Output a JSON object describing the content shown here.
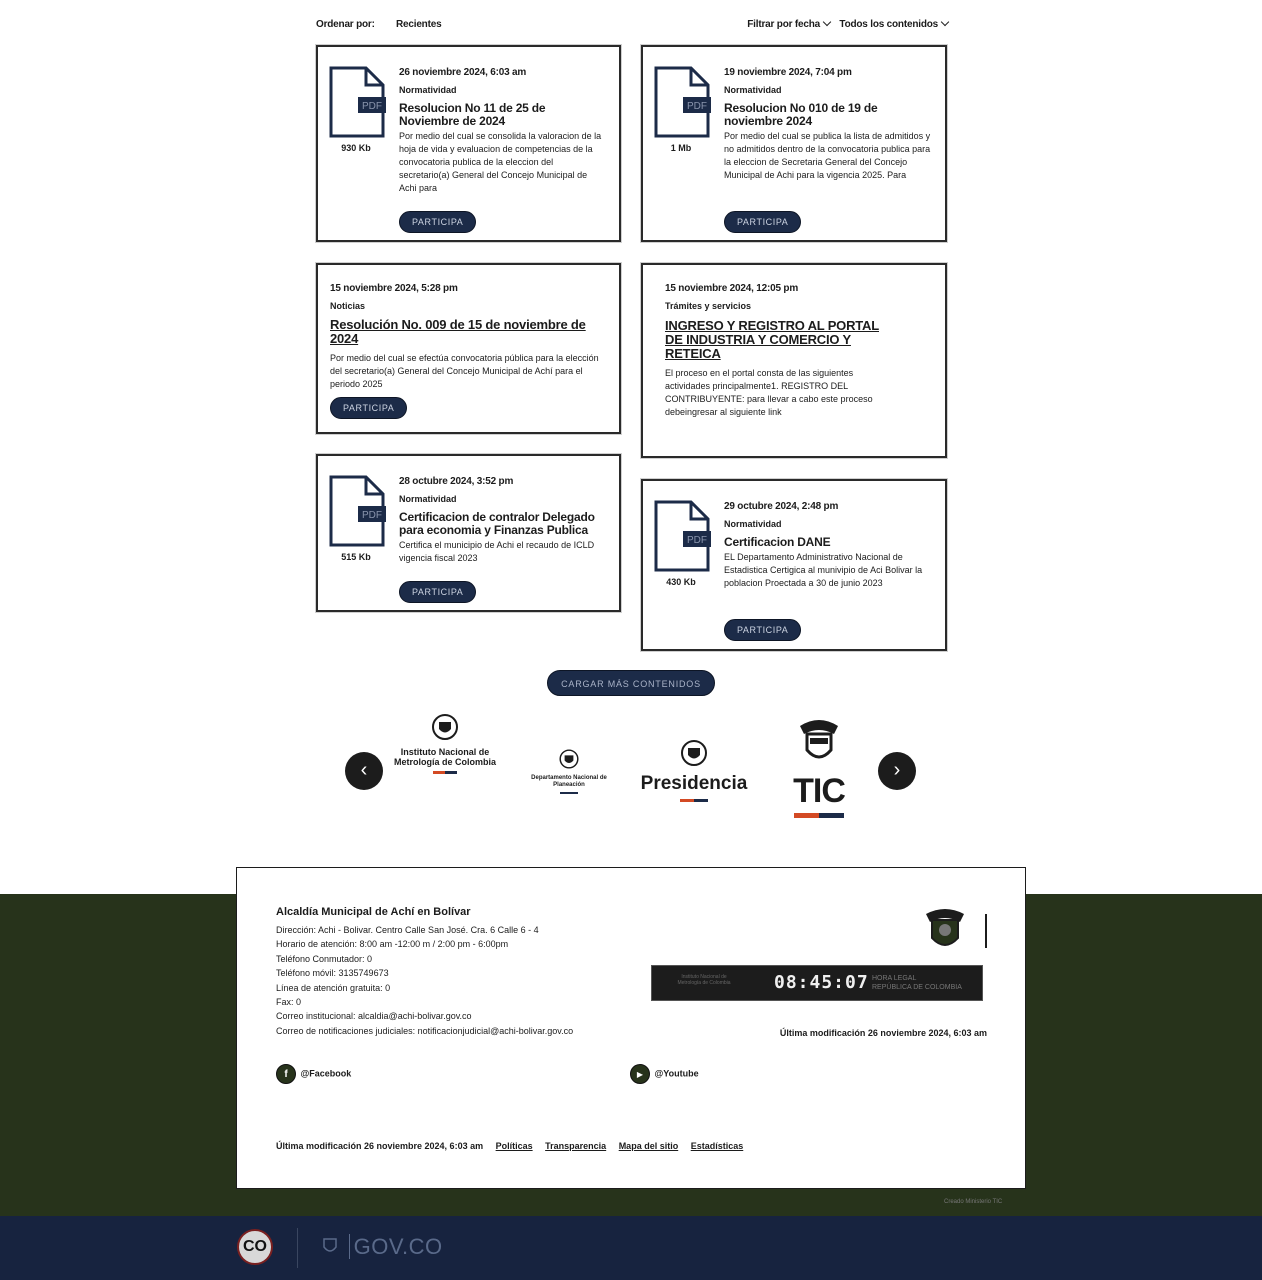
{
  "sort_bar": {
    "label": "Ordenar por:",
    "value": "Recientes",
    "filter_date": "Filtrar por fecha",
    "filter_content": "Todos los contenidos"
  },
  "cards": [
    {
      "date": "26 noviembre 2024, 6:03 am",
      "category": "Normatividad",
      "title": "Resolucion No 11 de 25 de Noviembre de 2024",
      "desc": "Por medio del cual se consolida la valoracion de la hoja de vida y evaluacion de competencias de la convocatoria publica de la eleccion del secretario(a) General del Concejo Municipal de Achi para",
      "file_type": "PDF",
      "file_size": "930 Kb",
      "button": "PARTICIPA"
    },
    {
      "date": "19 noviembre 2024, 7:04 pm",
      "category": "Normatividad",
      "title": "Resolucion No 010 de 19 de noviembre 2024",
      "desc": "Por medio del cual se publica la lista de admitidos y no admitidos dentro de la convocatoria publica para la eleccion de Secretaria General del Concejo Municipal de Achi para la vigencia 2025. Para",
      "file_type": "PDF",
      "file_size": "1 Mb",
      "button": "PARTICIPA"
    },
    {
      "date": "15 noviembre 2024, 5:28 pm",
      "category": "Noticias",
      "title": "Resolución No. 009 de 15 de noviembre de 2024",
      "desc": "Por medio del cual se efectúa convocatoria pública para la elección del secretario(a) General del Concejo Municipal de Achí para el periodo 2025",
      "button": "PARTICIPA"
    },
    {
      "date": "15 noviembre 2024, 12:05 pm",
      "category": "Trámites y servicios",
      "title": "INGRESO Y REGISTRO AL PORTAL DE INDUSTRIA Y COMERCIO Y RETEICA",
      "desc": "El proceso en el portal consta de las siguientes actividades principalmente1. REGISTRO DEL CONTRIBUYENTE: para llevar a cabo este proceso debeingresar al siguiente link"
    },
    {
      "date": "28 octubre 2024, 3:52 pm",
      "category": "Normatividad",
      "title": "Certificacion de contralor Delegado para economia y Finanzas Publica",
      "desc": "Certifica el municipio de Achi el recaudo de ICLD vigencia fiscal 2023",
      "file_type": "PDF",
      "file_size": "515 Kb",
      "button": "PARTICIPA"
    },
    {
      "date": "29 octubre 2024, 2:48 pm",
      "category": "Normatividad",
      "title": "Certificacion DANE",
      "desc": "EL Departamento Administrativo Nacional de Estadistica Certigica al munivipio de Aci Bolivar la poblacion Proectada a 30 de junio 2023",
      "file_type": "PDF",
      "file_size": "430 Kb",
      "button": "PARTICIPA"
    }
  ],
  "load_more": "CARGAR MÁS CONTENIDOS",
  "carousel": {
    "prev": "‹",
    "next": "›",
    "logos": [
      {
        "name": "Instituto Nacional de Metrología de Colombia"
      },
      {
        "name": "Departamento Nacional de Planeación"
      },
      {
        "name": "Presidencia"
      },
      {
        "name": "TIC"
      }
    ]
  },
  "footer": {
    "title": "Alcaldía Municipal de Achí en Bolívar",
    "lines": [
      "Dirección: Achi - Bolivar. Centro Calle San José. Cra. 6 Calle 6 - 4",
      "Horario de atención: 8:00 am -12:00 m / 2:00 pm - 6:00pm",
      "Teléfono Conmutador: 0",
      "Teléfono móvil: 3135749673",
      "Línea de atención gratuita: 0",
      "Fax: 0",
      "Correo institucional: alcaldia@achi-bolivar.gov.co",
      "Correo de notificaciones judiciales: notificacionjudicial@achi-bolivar.gov.co"
    ],
    "clock": {
      "time": "08:45:07",
      "label_line1": "HORA LEGAL",
      "label_line2": "REPÚBLICA DE COLOMBIA",
      "seal_text": "Instituto Nacional de Metrología de Colombia"
    },
    "last_modified": "Última modificación 26 noviembre 2024, 6:03 am",
    "social": [
      {
        "icon": "f",
        "label": "@Facebook"
      },
      {
        "icon": "▶",
        "label": "@Youtube"
      }
    ],
    "bottom_modified": "Última modificación 26 noviembre 2024, 6:03 am",
    "links": [
      "Políticas",
      "Transparencia",
      "Mapa del sitio",
      "Estadísticas"
    ],
    "credit": "Creado Ministerio TIC"
  },
  "gov_bar": {
    "co": "CO",
    "gov_text": "GOV.CO"
  },
  "colors": {
    "primary_dark": "#1c2b48",
    "footer_green": "#27331b",
    "gov_navy": "#17233f"
  }
}
